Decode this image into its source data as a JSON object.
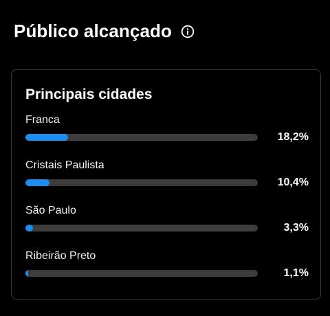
{
  "header": {
    "title": "Público alcançado",
    "info_icon": "info-circle-icon"
  },
  "card": {
    "title": "Principais cidades",
    "accent_color": "#1d8ef0",
    "track_color": "#3c3c3c",
    "cities": [
      {
        "name": "Franca",
        "percent_label": "18,2%",
        "fill_fraction": 0.182
      },
      {
        "name": "Cristais Paulista",
        "percent_label": "10,4%",
        "fill_fraction": 0.104
      },
      {
        "name": "São Paulo",
        "percent_label": "3,3%",
        "fill_fraction": 0.033
      },
      {
        "name": "Ribeirão Preto",
        "percent_label": "1,1%",
        "fill_fraction": 0.011
      }
    ]
  }
}
